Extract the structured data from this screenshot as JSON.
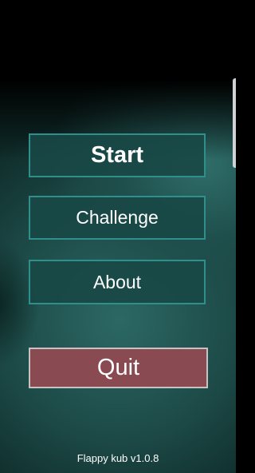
{
  "menu": {
    "start_label": "Start",
    "challenge_label": "Challenge",
    "about_label": "About",
    "quit_label": "Quit"
  },
  "footer": {
    "version": "Flappy kub v1.0.8"
  },
  "colors": {
    "button_fill": "#184846",
    "button_border": "#2f8f8a",
    "quit_fill": "#8a4a52",
    "quit_border": "#c9c2c2",
    "background": "#1d4946"
  }
}
